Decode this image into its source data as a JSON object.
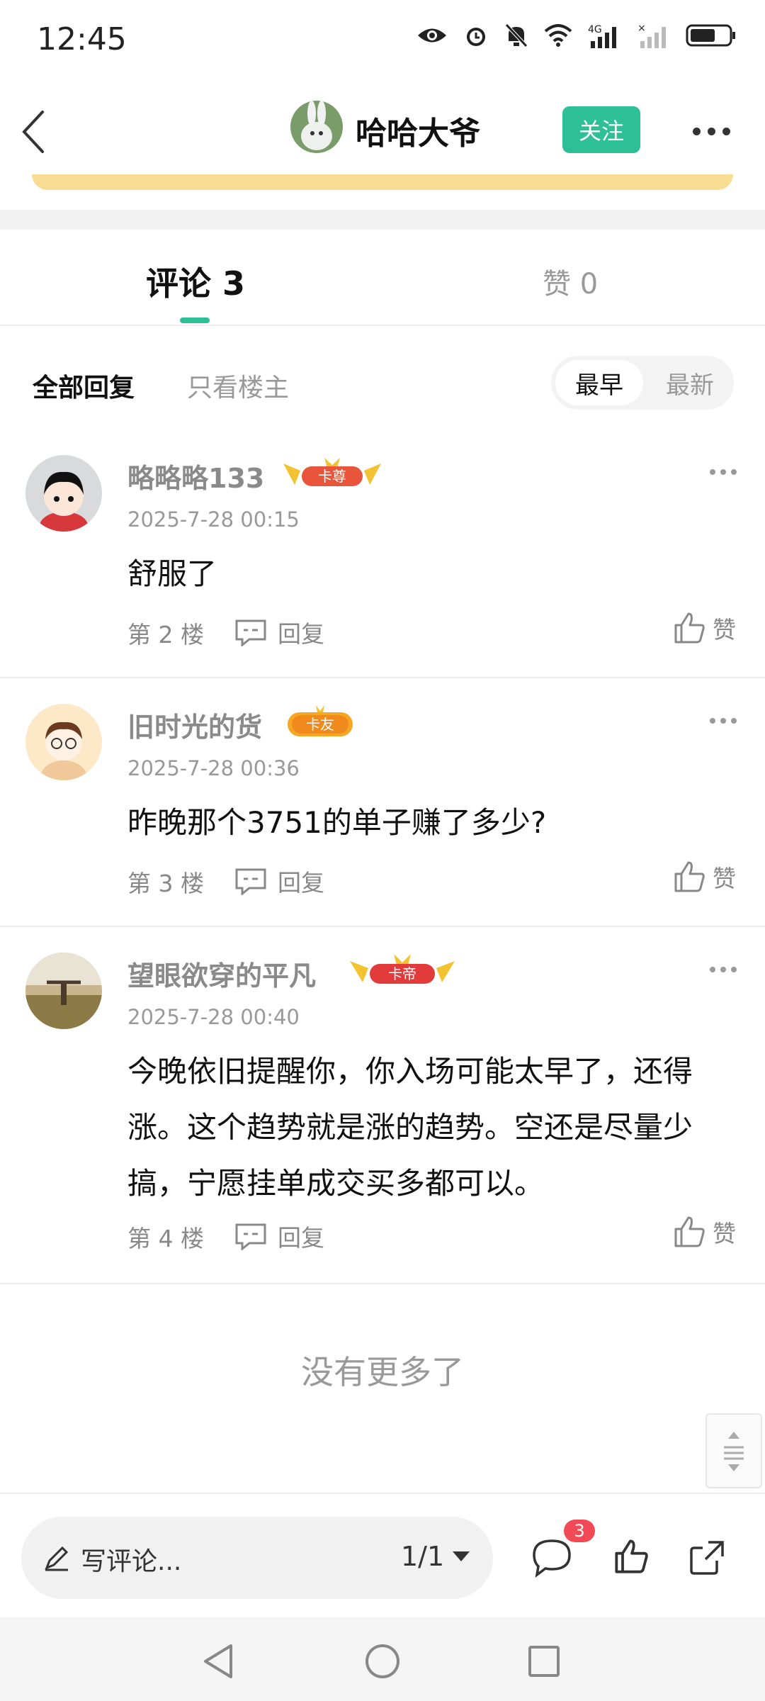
{
  "status_bar": {
    "time": "12:45"
  },
  "header": {
    "author_name": "哈哈大爷",
    "follow_label": "关注"
  },
  "tabs": {
    "comments_label": "评论 3",
    "likes_label": "赞 0"
  },
  "filter": {
    "all_label": "全部回复",
    "op_only_label": "只看楼主",
    "sort_earliest": "最早",
    "sort_latest": "最新"
  },
  "comments": [
    {
      "username": "略略略133",
      "badge": "卡尊",
      "time": "2025-7-28 00:15",
      "text": "舒服了",
      "floor": "第 2 楼",
      "reply_label": "回复",
      "like_label": "赞"
    },
    {
      "username": "旧时光的货",
      "badge": "卡友",
      "time": "2025-7-28 00:36",
      "text": "昨晚那个3751的单子赚了多少?",
      "floor": "第 3 楼",
      "reply_label": "回复",
      "like_label": "赞"
    },
    {
      "username": "望眼欲穿的平凡",
      "badge": "卡帝",
      "time": "2025-7-28 00:40",
      "text": "今晚依旧提醒你，你入场可能太早了，还得涨。这个趋势就是涨的趋势。空还是尽量少搞，宁愿挂单成交买多都可以。",
      "floor": "第 4 楼",
      "reply_label": "回复",
      "like_label": "赞"
    }
  ],
  "footer": {
    "no_more": "没有更多了"
  },
  "bottom_bar": {
    "input_placeholder": "写评论...",
    "page_indicator": "1/1",
    "comment_count": "3"
  },
  "colors": {
    "accent": "#2dbf95",
    "badge_red": "#f24957"
  }
}
